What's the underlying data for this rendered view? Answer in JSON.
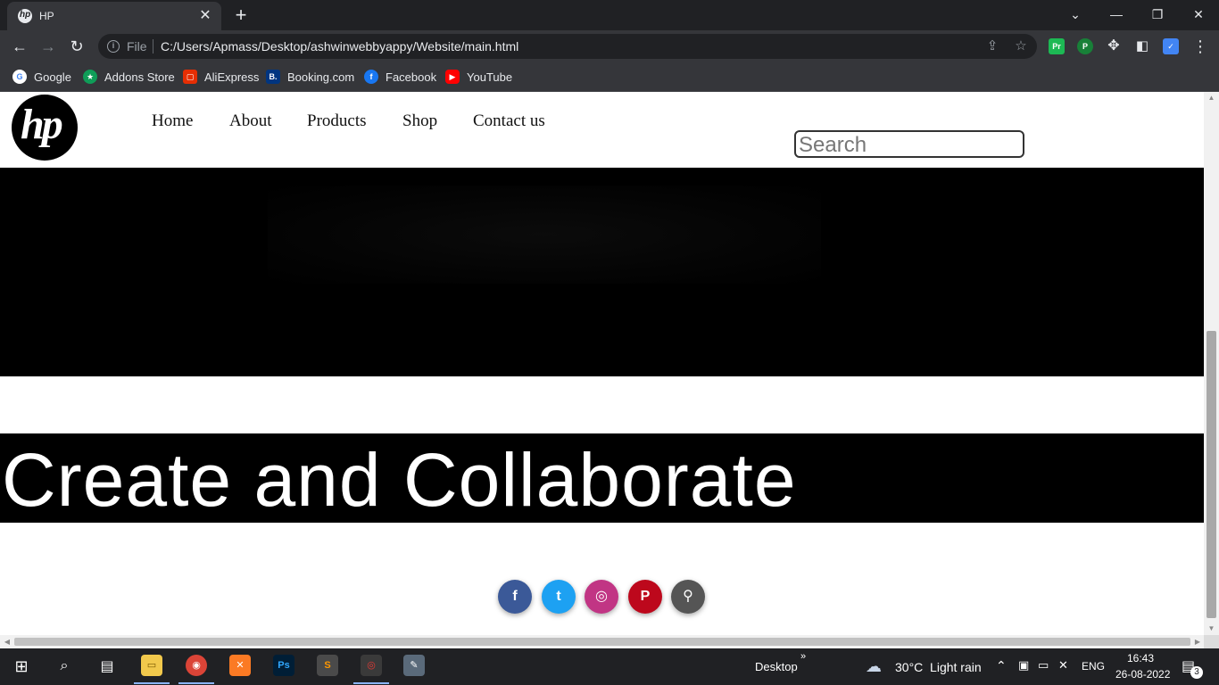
{
  "browser": {
    "tab_title": "HP",
    "tab_close": "✕",
    "new_tab": "+",
    "omnibox_scheme": "File",
    "url": "C:/Users/Apmass/Desktop/ashwinwebbyappy/Website/main.html",
    "extensions": [
      "Pr",
      "P"
    ],
    "bookmarks": [
      "Google",
      "Addons Store",
      "AliExpress",
      "Booking.com",
      "Facebook",
      "YouTube"
    ]
  },
  "site": {
    "logo_text": "hp",
    "nav": [
      "Home",
      "About",
      "Products",
      "Shop",
      "Contact us"
    ],
    "search_placeholder": "Search",
    "banner_text": "Create and Collaborate",
    "socials": [
      {
        "name": "facebook",
        "glyph": "f",
        "color": "#3b5998"
      },
      {
        "name": "twitter",
        "glyph": "t",
        "color": "#1da1f2"
      },
      {
        "name": "instagram",
        "glyph": "◎",
        "color": "#c13584"
      },
      {
        "name": "pinterest",
        "glyph": "P",
        "color": "#bd081c"
      },
      {
        "name": "steam",
        "glyph": "⚲",
        "color": "#555555"
      }
    ]
  },
  "taskbar": {
    "desktop_label": "Desktop",
    "weather": "30°C  Light rain",
    "language": "ENG",
    "time": "16:43",
    "date": "26-08-2022",
    "notification_count": "3"
  }
}
